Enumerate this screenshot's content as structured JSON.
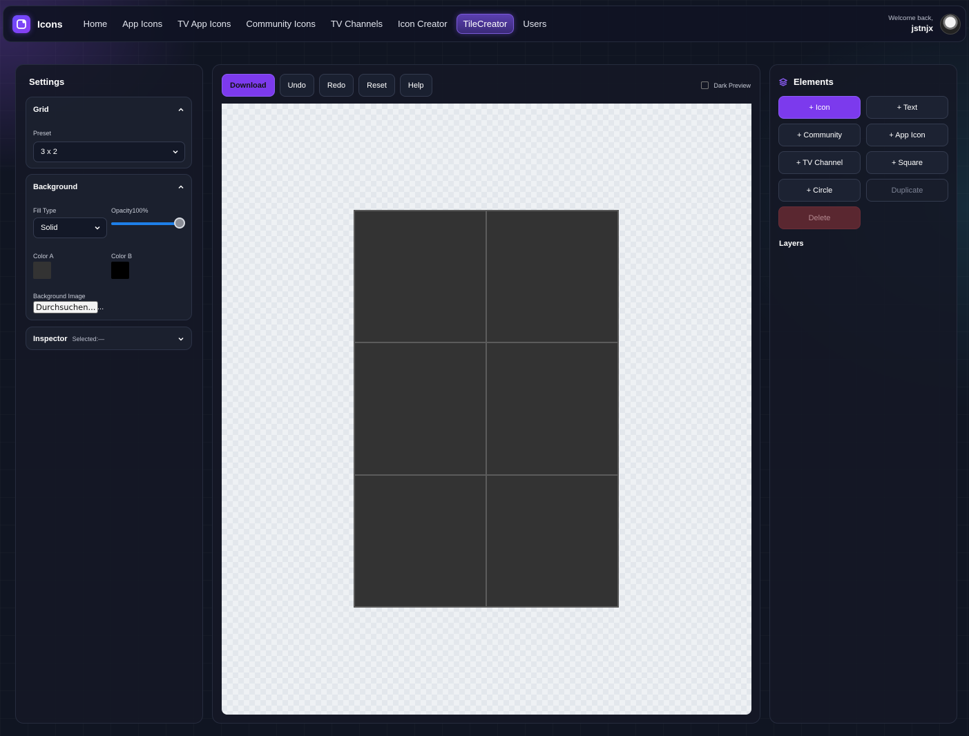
{
  "nav": {
    "brand": "Icons",
    "links": [
      {
        "label": "Home"
      },
      {
        "label": "App Icons"
      },
      {
        "label": "TV App Icons"
      },
      {
        "label": "Community Icons"
      },
      {
        "label": "TV Channels"
      },
      {
        "label": "Icon Creator"
      },
      {
        "label": "TileCreator",
        "active": true
      },
      {
        "label": "Users"
      }
    ],
    "welcome": "Welcome back,",
    "username": "jstnjx"
  },
  "settings": {
    "title": "Settings",
    "grid": {
      "title": "Grid",
      "preset_label": "Preset",
      "preset_value": "3 x 2"
    },
    "background": {
      "title": "Background",
      "fill_type_label": "Fill Type",
      "fill_type_value": "Solid",
      "opacity_label": "Opacity",
      "opacity_value": "100%",
      "opacity_fraction": 1.0,
      "color_a_label": "Color A",
      "color_a": "#333333",
      "color_b_label": "Color B",
      "color_b": "#000000",
      "image_label": "Background Image",
      "browse_label": "Durchsuchen...",
      "file_name": "..."
    },
    "inspector": {
      "title": "Inspector",
      "selected": "Selected:—"
    }
  },
  "toolbar": {
    "download": "Download",
    "undo": "Undo",
    "redo": "Redo",
    "reset": "Reset",
    "help": "Help",
    "dark_preview": "Dark Preview"
  },
  "canvas": {
    "rows": 3,
    "cols": 2,
    "tile_color": "#333333"
  },
  "elements": {
    "title": "Elements",
    "buttons": {
      "icon": "+ Icon",
      "text": "+ Text",
      "community": "+ Community",
      "app_icon": "+ App Icon",
      "tv_channel": "+ TV Channel",
      "square": "+ Square",
      "circle": "+ Circle",
      "duplicate": "Duplicate",
      "delete": "Delete"
    },
    "layers_label": "Layers"
  },
  "colors": {
    "accent": "#7c3aed",
    "slider": "#1e7fe8",
    "danger": "#5a2730"
  }
}
